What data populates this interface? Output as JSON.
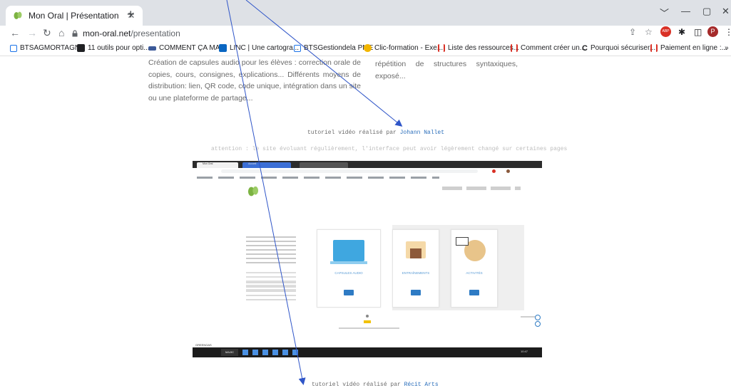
{
  "browser": {
    "tab_title": "Mon Oral | Présentation",
    "tab_close": "✕",
    "new_tab": "+",
    "url_host": "mon-oral.net",
    "url_path": "/presentation",
    "window_controls": [
      "﹀",
      "—",
      "▢",
      "✕"
    ],
    "profile_initial": "P",
    "adblock_label": "ABP",
    "bookmarks": [
      {
        "label": "BTSAGMORTAGNE",
        "color": "#1a73e8"
      },
      {
        "label": "11 outils pour opti...",
        "color": "#202124"
      },
      {
        "label": "COMMENT ÇA MA...",
        "color": "#3b5998"
      },
      {
        "label": "LINC | Une cartogra...",
        "color": "#0a66c2"
      },
      {
        "label": "BTSGestiondela PME",
        "color": "#1a73e8"
      },
      {
        "label": "Clic-formation - Exe...",
        "color": "#f2b600"
      },
      {
        "label": "Liste des ressources...",
        "color": "#d93025"
      },
      {
        "label": "Comment créer un...",
        "color": "#d93025"
      },
      {
        "label": "Pourquoi sécuriser...",
        "color": "#202124"
      },
      {
        "label": "Paiement en ligne :...",
        "color": "#d93025"
      }
    ],
    "bookmarks_overflow": "»"
  },
  "page": {
    "left_paragraph": "Création de capsules audio pour les élèves : correction orale de copies, cours, consignes, explications... Différents moyens de distribution: lien, QR code, code unique, intégration dans un site ou une plateforme de partage...",
    "right_paragraph": "répétition de structures syntaxiques, exposé...",
    "tutorial1_prefix": "tutoriel vidéo réalisé par ",
    "tutorial1_author": "Johann Nallet",
    "warning": "attention : le site évoluant régulièrement, l'interface peut avoir légèrement changé sur certaines pages",
    "tutorial2_prefix": "tutoriel vidéo réalisé par ",
    "tutorial2_author": "Récit Arts"
  },
  "embedded_screenshot": {
    "tab1": "Mon Oral",
    "tab2": "Accueil",
    "card_labels": [
      "CAPSULES AUDIO",
      "ENTRAÎNEMENTS",
      "ACTIVITÉS"
    ],
    "taskbar_tag": "GREENGAS",
    "taskbar_button": "MAJIC",
    "clock": "10:47"
  },
  "colors": {
    "link": "#2a6ebb",
    "arrow": "#2f55c8",
    "accent_blue": "#2e7bc4"
  }
}
